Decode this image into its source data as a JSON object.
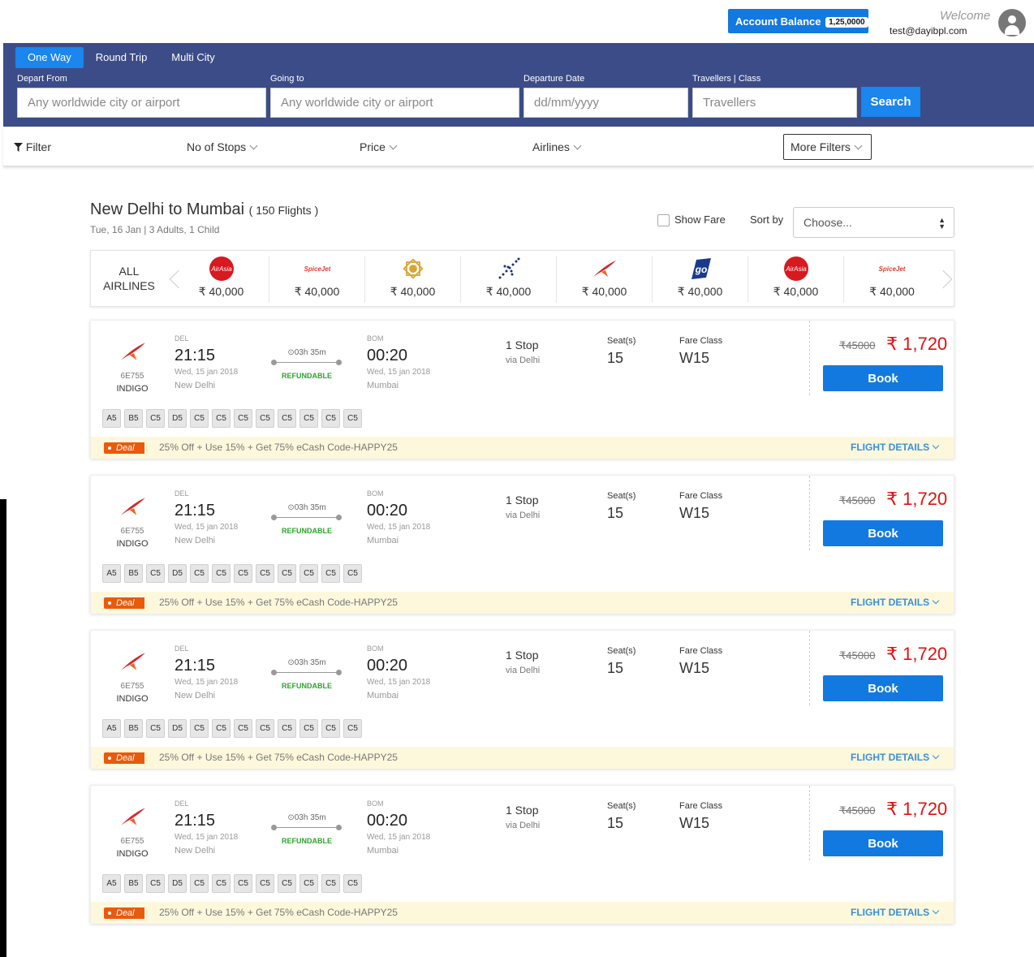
{
  "header": {
    "account_balance_label": "Account Balance",
    "account_balance_value": "1,25,0000",
    "welcome": "Welcome",
    "email": "test@dayibpl.com"
  },
  "search": {
    "tabs": [
      {
        "label": "One Way",
        "active": true
      },
      {
        "label": "Round Trip",
        "active": false
      },
      {
        "label": "Multi City",
        "active": false
      }
    ],
    "depart_label": "Depart From",
    "depart_placeholder": "Any worldwide city or airport",
    "going_label": "Going to",
    "going_placeholder": "Any worldwide city or airport",
    "date_label": "Departure Date",
    "date_placeholder": "dd/mm/yyyy",
    "travellers_label": "Travellers | Class",
    "travellers_placeholder": "Travellers",
    "search_button": "Search"
  },
  "filters": {
    "filter": "Filter",
    "stops": "No of Stops",
    "price": "Price",
    "airlines": "Airlines",
    "more": "More Filters"
  },
  "results": {
    "route": "New Delhi to Mumbai",
    "count": "( 150 Flights )",
    "meta": "Tue, 16 Jan | 3 Adults, 1 Child",
    "show_fare": "Show Fare",
    "sort_by": "Sort by",
    "sort_value": "Choose..."
  },
  "airline_strip": {
    "all_label_1": "ALL",
    "all_label_2": "AIRLINES",
    "items": [
      {
        "logo": "airasia-logo",
        "price": "₹ 40,000"
      },
      {
        "logo": "spicejet-logo",
        "price": "₹ 40,000"
      },
      {
        "logo": "jetairways-logo",
        "price": "₹ 40,000"
      },
      {
        "logo": "indigo-logo",
        "price": "₹ 40,000"
      },
      {
        "logo": "airindia-logo",
        "price": "₹ 40,000"
      },
      {
        "logo": "goair-logo",
        "price": "₹ 40,000"
      },
      {
        "logo": "airasia-logo",
        "price": "₹ 40,000"
      },
      {
        "logo": "spicejet-logo",
        "price": "₹ 40,000"
      }
    ]
  },
  "flights": [
    {
      "code": "6E755",
      "airline": "INDIGO",
      "dep_code": "DEL",
      "dep_time": "21:15",
      "dep_date": "Wed, 15 jan 2018",
      "dep_city": "New Delhi",
      "duration": "03h 35m",
      "refundable": "REFUNDABLE",
      "arr_code": "BOM",
      "arr_time": "00:20",
      "arr_date": "Wed, 15 jan 2018",
      "arr_city": "Mumbai",
      "stops": "1 Stop",
      "via": "via Delhi",
      "seat_label": "Seat(s)",
      "seats": "15",
      "fare_label": "Fare Class",
      "fare_class": "W15",
      "old_price": "₹45000",
      "price": "₹ 1,720",
      "book": "Book",
      "classes": [
        "A5",
        "B5",
        "C5",
        "D5",
        "C5",
        "C5",
        "C5",
        "C5",
        "C5",
        "C5",
        "C5",
        "C5"
      ],
      "deal_tag": "Deal",
      "deal_text": "25% Off + Use 15% + Get 75% eCash Code-HAPPY25",
      "details": "FLIGHT DETAILS"
    },
    {
      "code": "6E755",
      "airline": "INDIGO",
      "dep_code": "DEL",
      "dep_time": "21:15",
      "dep_date": "Wed, 15 jan 2018",
      "dep_city": "New Delhi",
      "duration": "03h 35m",
      "refundable": "REFUNDABLE",
      "arr_code": "BOM",
      "arr_time": "00:20",
      "arr_date": "Wed, 15 jan 2018",
      "arr_city": "Mumbai",
      "stops": "1 Stop",
      "via": "via Delhi",
      "seat_label": "Seat(s)",
      "seats": "15",
      "fare_label": "Fare Class",
      "fare_class": "W15",
      "old_price": "₹45000",
      "price": "₹ 1,720",
      "book": "Book",
      "classes": [
        "A5",
        "B5",
        "C5",
        "D5",
        "C5",
        "C5",
        "C5",
        "C5",
        "C5",
        "C5",
        "C5",
        "C5"
      ],
      "deal_tag": "Deal",
      "deal_text": "25% Off + Use 15% + Get 75% eCash Code-HAPPY25",
      "details": "FLIGHT DETAILS"
    },
    {
      "code": "6E755",
      "airline": "INDIGO",
      "dep_code": "DEL",
      "dep_time": "21:15",
      "dep_date": "Wed, 15 jan 2018",
      "dep_city": "New Delhi",
      "duration": "03h 35m",
      "refundable": "REFUNDABLE",
      "arr_code": "BOM",
      "arr_time": "00:20",
      "arr_date": "Wed, 15 jan 2018",
      "arr_city": "Mumbai",
      "stops": "1 Stop",
      "via": "via Delhi",
      "seat_label": "Seat(s)",
      "seats": "15",
      "fare_label": "Fare Class",
      "fare_class": "W15",
      "old_price": "₹45000",
      "price": "₹ 1,720",
      "book": "Book",
      "classes": [
        "A5",
        "B5",
        "C5",
        "D5",
        "C5",
        "C5",
        "C5",
        "C5",
        "C5",
        "C5",
        "C5",
        "C5"
      ],
      "deal_tag": "Deal",
      "deal_text": "25% Off + Use 15% + Get 75% eCash Code-HAPPY25",
      "details": "FLIGHT DETAILS"
    },
    {
      "code": "6E755",
      "airline": "INDIGO",
      "dep_code": "DEL",
      "dep_time": "21:15",
      "dep_date": "Wed, 15 jan 2018",
      "dep_city": "New Delhi",
      "duration": "03h 35m",
      "refundable": "REFUNDABLE",
      "arr_code": "BOM",
      "arr_time": "00:20",
      "arr_date": "Wed, 15 jan 2018",
      "arr_city": "Mumbai",
      "stops": "1 Stop",
      "via": "via Delhi",
      "seat_label": "Seat(s)",
      "seats": "15",
      "fare_label": "Fare Class",
      "fare_class": "W15",
      "old_price": "₹45000",
      "price": "₹ 1,720",
      "book": "Book",
      "classes": [
        "A5",
        "B5",
        "C5",
        "D5",
        "C5",
        "C5",
        "C5",
        "C5",
        "C5",
        "C5",
        "C5",
        "C5"
      ],
      "deal_tag": "Deal",
      "deal_text": "25% Off + Use 15% + Get 75% eCash Code-HAPPY25",
      "details": "FLIGHT DETAILS"
    }
  ],
  "colors": {
    "primary": "#1279e0",
    "search_bg": "#3c4c88",
    "price_red": "#e01010",
    "deal_orange": "#ea5a0c",
    "deal_bg": "#fdf8dc",
    "refundable_green": "#2ba52b"
  }
}
